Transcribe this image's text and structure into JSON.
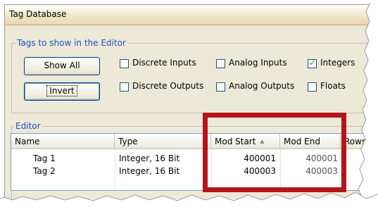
{
  "window": {
    "title": "Tag Database"
  },
  "filter_group": {
    "legend": "Tags to show in the Editor",
    "show_all_label": "Show All",
    "invert_label": "Invert",
    "checkboxes": [
      {
        "label": "Discrete Inputs",
        "checked": false
      },
      {
        "label": "Analog Inputs",
        "checked": false
      },
      {
        "label": "Integers",
        "checked": true
      },
      {
        "label": "Discrete Outputs",
        "checked": false
      },
      {
        "label": "Analog Outputs",
        "checked": false
      },
      {
        "label": "Floats",
        "checked": false
      }
    ]
  },
  "editor": {
    "legend": "Editor",
    "columns": [
      "Name",
      "Type",
      "Mod Start",
      "Mod End",
      "Rows"
    ],
    "sort_indicator": "▲",
    "rows": [
      {
        "name": "Tag 1",
        "type": "Integer, 16 Bit",
        "mod_start": "400001",
        "mod_end": "400001"
      },
      {
        "name": "Tag 2",
        "type": "Integer, 16 Bit",
        "mod_start": "400003",
        "mod_end": "400003"
      }
    ]
  },
  "colors": {
    "highlight_box": "#b3151a",
    "legend_text": "#1f4fbf"
  }
}
